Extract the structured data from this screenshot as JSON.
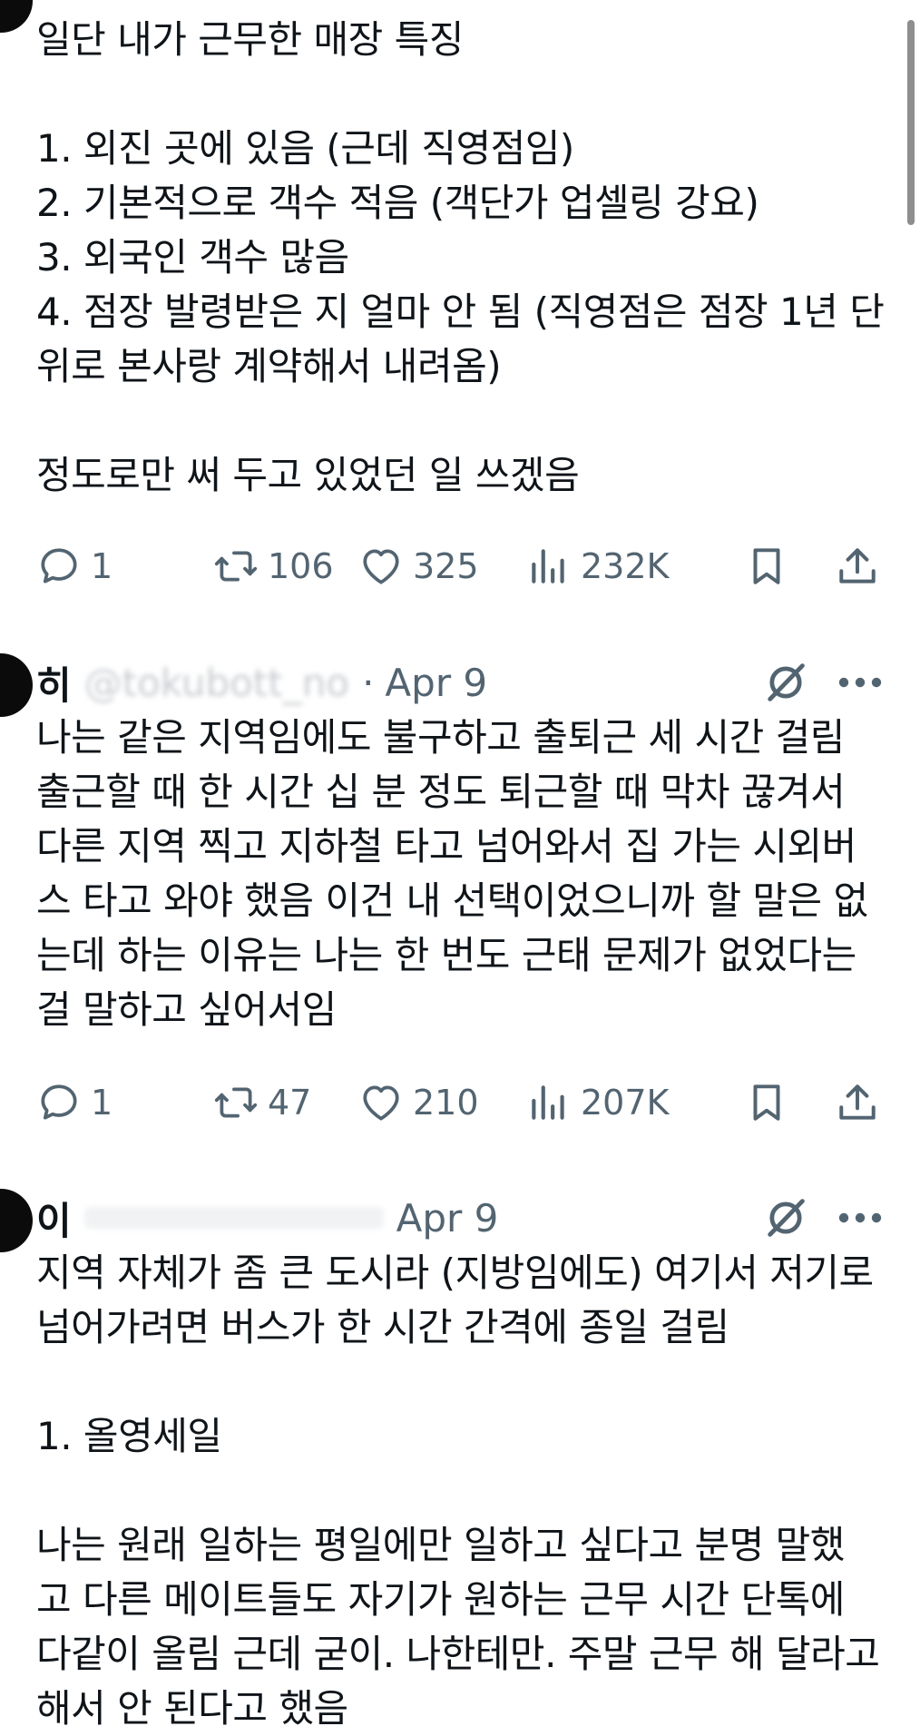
{
  "tweets": [
    {
      "text": "일단 내가 근무한 매장 특징\n\n1. 외진 곳에 있음 (근데 직영점임)\n2. 기본적으로 객수 적음 (객단가 업셀링 강요)\n3. 외국인 객수 많음\n4. 점장 발령받은 지 얼마 안 됨 (직영점은 점장 1년 단\n위로 본사랑 계약해서 내려옴)\n\n정도로만 써 두고 있었던 일 쓰겠음",
      "replies": "1",
      "reposts": "106",
      "likes": "325",
      "views": "232K"
    },
    {
      "name": "히",
      "handle": "@tokubott_no",
      "date": "Apr 9",
      "text": "나는 같은 지역임에도 불구하고 출퇴근 세 시간 걸림\n출근할 때 한 시간 십 분 정도 퇴근할 때 막차 끊겨서\n다른 지역 찍고 지하철 타고 넘어와서 집 가는 시외버\n스 타고 와야 했음 이건 내 선택이었으니까 할 말은 없\n는데 하는 이유는 나는 한 번도 근태 문제가 없었다는\n걸 말하고 싶어서임",
      "replies": "1",
      "reposts": "47",
      "likes": "210",
      "views": "207K"
    },
    {
      "name": "이",
      "date": "Apr 9",
      "text": "지역 자체가 좀 큰 도시라 (지방임에도) 여기서 저기로\n넘어가려면 버스가 한 시간 간격에 종일 걸림\n\n1. 올영세일\n\n나는 원래 일하는 평일에만 일하고 싶다고 분명 말했\n고 다른 메이트들도 자기가 원하는 근무 시간 단톡에\n다같이 올림 근데 굳이. 나한테만. 주말 근무 해 달라고\n해서 안 된다고 했음"
    }
  ],
  "icons": {
    "reply": "speech-bubble-icon",
    "repost": "repost-arrows-icon",
    "like": "heart-icon",
    "views": "bar-chart-icon",
    "bookmark": "bookmark-icon",
    "share": "share-upload-icon",
    "grok": "grok-slash-icon",
    "more": "more-dots-icon"
  },
  "colors": {
    "text": "#0f1419",
    "secondary": "#536471",
    "avatar": "#0b0b0b"
  }
}
